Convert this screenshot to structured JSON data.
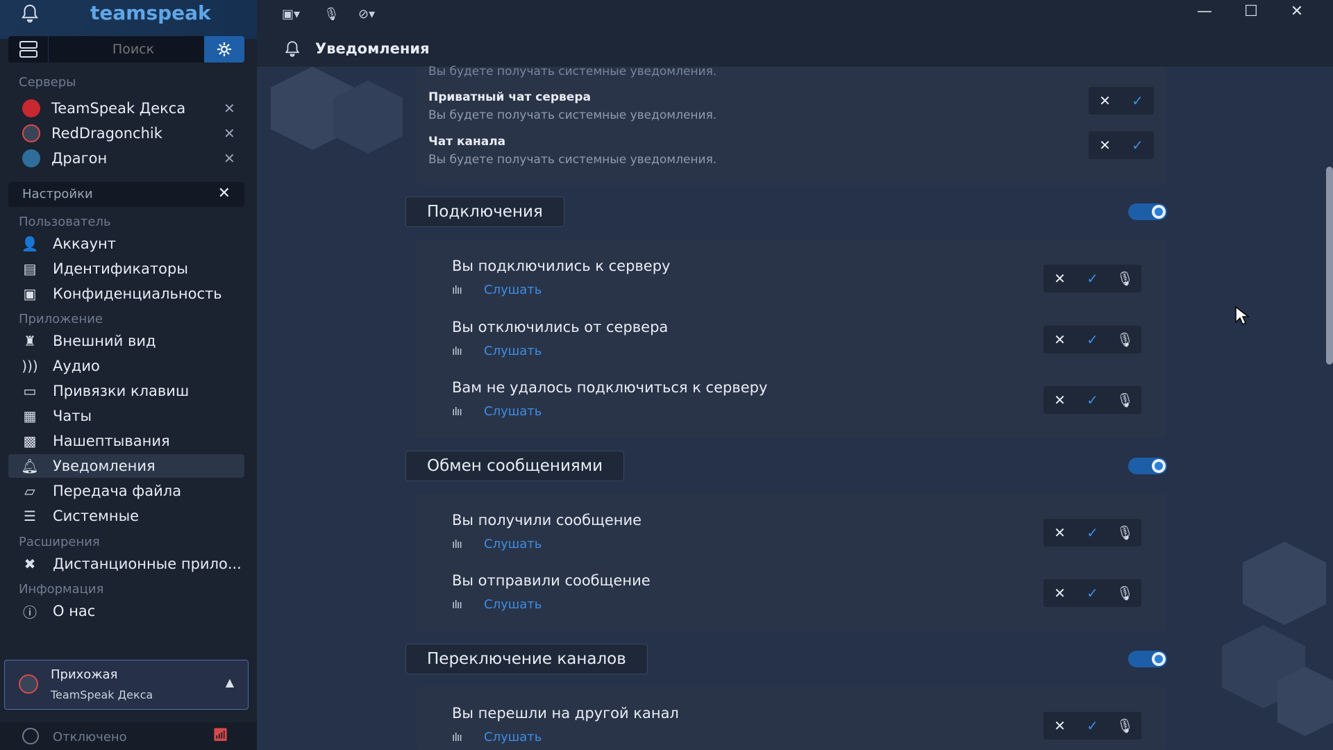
{
  "app": {
    "brand": "teamspeak"
  },
  "search": {
    "placeholder": "Поиск"
  },
  "sidebar": {
    "servers_label": "Серверы",
    "servers": [
      {
        "label": "TeamSpeak Декса",
        "icon": "teamspeak-play-icon"
      },
      {
        "label": "RedDragonchik",
        "icon": "teamspeak-logo-icon"
      },
      {
        "label": "Драгон",
        "icon": "circle-icon"
      }
    ],
    "settings_label": "Настройки",
    "sections": [
      {
        "label": "Пользователь",
        "items": [
          {
            "label": "Аккаунт",
            "icon": "user-icon"
          },
          {
            "label": "Идентификаторы",
            "icon": "id-card-icon"
          },
          {
            "label": "Конфиденциальность",
            "icon": "lock-icon"
          }
        ]
      },
      {
        "label": "Приложение",
        "items": [
          {
            "label": "Внешний вид",
            "icon": "brush-icon"
          },
          {
            "label": "Аудио",
            "icon": "sound-icon"
          },
          {
            "label": "Привязки клавиш",
            "icon": "keyboard-icon"
          },
          {
            "label": "Чаты",
            "icon": "chat-icon"
          },
          {
            "label": "Нашептывания",
            "icon": "whisper-icon"
          },
          {
            "label": "Уведомления",
            "icon": "bell-icon"
          },
          {
            "label": "Передача файла",
            "icon": "folder-icon"
          },
          {
            "label": "Системные",
            "icon": "system-icon"
          }
        ]
      },
      {
        "label": "Расширения",
        "items": [
          {
            "label": "Дистанционные прило...",
            "icon": "puzzle-icon"
          }
        ]
      },
      {
        "label": "Информация",
        "items": [
          {
            "label": "О нас",
            "icon": "info-icon"
          }
        ]
      }
    ],
    "current_channel": {
      "channel": "Прихожая",
      "server": "TeamSpeak Декса"
    },
    "status": "Отключено"
  },
  "main": {
    "title": "Уведомления",
    "top_partial": "Вы будете получать системные уведомления.",
    "top_items": [
      {
        "title": "Приватный чат сервера",
        "desc": "Вы будете получать системные уведомления."
      },
      {
        "title": "Чат канала",
        "desc": "Вы будете получать системные уведомления."
      }
    ],
    "listen": "Слушать",
    "groups": [
      {
        "title": "Подключения",
        "items": [
          "Вы подключились к серверу",
          "Вы отключились от сервера",
          "Вам не удалось подключиться к серверу"
        ]
      },
      {
        "title": "Обмен сообщениями",
        "items": [
          "Вы получили сообщение",
          "Вы отправили сообщение"
        ]
      },
      {
        "title": "Переключение каналов",
        "items": [
          "Вы перешли на другой канал"
        ]
      }
    ]
  },
  "colors": {
    "accent": "#3b8ee6",
    "toggle": "#1d5ea8"
  }
}
